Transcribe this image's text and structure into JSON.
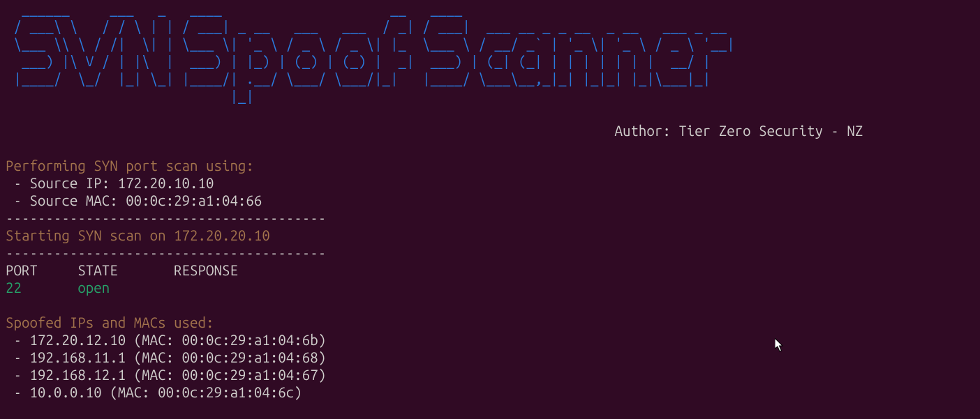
{
  "banner": [
    "  ______     ___   _   ____                     __   ____                                 ",
    " / ___\\ \\   / / \\ | | / ___| _ __   ___   ___  / _| / ___|  ___ __ _ _ __  _ __   ___ _ __ ",
    " \\___ \\\\ \\ / /|  \\| | \\___ \\| '_ \\ / _ \\ / _ \\| |_  \\___ \\ / __/ _` | '_ \\| '_ \\ / _ \\ '__|",
    "  ___) |\\ V / | |\\  |  ___) | |_) | (_) | (_) |  _|  ___) | (_| (_| | | | | | | |  __/ |   ",
    " |____/  \\_/  |_| \\_| |____/| .__/ \\___/ \\___/|_|   |____/ \\___\\__,_|_| |_|_| |_|\\___|_|   ",
    "                            |_|                                                            "
  ],
  "author_line": "                                                                            Author: Tier Zero Security - NZ",
  "blank": "",
  "perform_header": "Performing SYN port scan using:",
  "source_ip": " - Source IP: 172.20.10.10",
  "source_mac": " - Source MAC: 00:0c:29:a1:04:66",
  "rule": "----------------------------------------",
  "starting": "Starting SYN scan on 172.20.20.10",
  "table_header": "PORT     STATE       RESPONSE",
  "port_col": "22       ",
  "state_col": "open",
  "spoof_header": "Spoofed IPs and MACs used:",
  "spoof_rows": [
    " - 172.20.12.10 (MAC: 00:0c:29:a1:04:6b)",
    " - 192.168.11.1 (MAC: 00:0c:29:a1:04:68)",
    " - 192.168.12.1 (MAC: 00:0c:29:a1:04:67)",
    " - 10.0.0.10 (MAC: 00:0c:29:a1:04:6c)"
  ]
}
